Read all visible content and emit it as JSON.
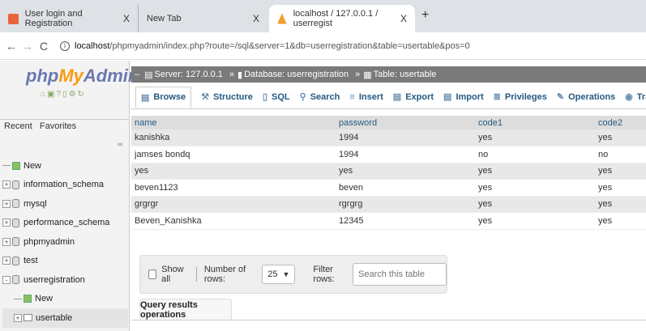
{
  "browser": {
    "tabs": [
      {
        "title": "User login and Registration",
        "close": "X"
      },
      {
        "title": "New Tab",
        "close": "X"
      },
      {
        "title": "localhost / 127.0.0.1 / userregist",
        "close": "X"
      }
    ],
    "new_tab": "+",
    "url_host": "localhost",
    "url_rest": "/phpmyadmin/index.php?route=/sql&server=1&db=userregistration&table=usertable&pos=0"
  },
  "sidebar": {
    "logo": {
      "php": "php",
      "my": "My",
      "admin": "Admin"
    },
    "tabs": [
      "Recent",
      "Favorites"
    ],
    "tree": [
      {
        "label": "New",
        "type": "new",
        "expander": ""
      },
      {
        "label": "information_schema",
        "type": "db",
        "expander": "+"
      },
      {
        "label": "mysql",
        "type": "db",
        "expander": "+"
      },
      {
        "label": "performance_schema",
        "type": "db",
        "expander": "+"
      },
      {
        "label": "phpmyadmin",
        "type": "db",
        "expander": "+"
      },
      {
        "label": "test",
        "type": "db",
        "expander": "+"
      },
      {
        "label": "userregistration",
        "type": "db",
        "expander": "-"
      },
      {
        "label": "New",
        "type": "new-child",
        "expander": ""
      },
      {
        "label": "usertable",
        "type": "table",
        "expander": "+"
      }
    ]
  },
  "breadcrumb": {
    "server": "Server: 127.0.0.1",
    "database": "Database: userregistration",
    "table": "Table: usertable",
    "separator": "»"
  },
  "menu": [
    "Browse",
    "Structure",
    "SQL",
    "Search",
    "Insert",
    "Export",
    "Import",
    "Privileges",
    "Operations",
    "Tracking"
  ],
  "table": {
    "headers": [
      "name",
      "password",
      "code1",
      "code2"
    ],
    "rows": [
      [
        "kanishka",
        "1994",
        "yes",
        "yes"
      ],
      [
        "jamses bondq",
        "1994",
        "no",
        "no"
      ],
      [
        "yes",
        "yes",
        "yes",
        "yes"
      ],
      [
        "beven1123",
        "beven",
        "yes",
        "yes"
      ],
      [
        "grgrgr",
        "rgrgrg",
        "yes",
        "yes"
      ],
      [
        "Beven_Kanishka",
        "12345",
        "yes",
        "yes"
      ]
    ]
  },
  "controls": {
    "show_all": "Show all",
    "rows_label": "Number of rows:",
    "rows_value": "25",
    "filter_label": "Filter rows:",
    "filter_placeholder": "Search this table"
  },
  "query_results_label": "Query results operations"
}
